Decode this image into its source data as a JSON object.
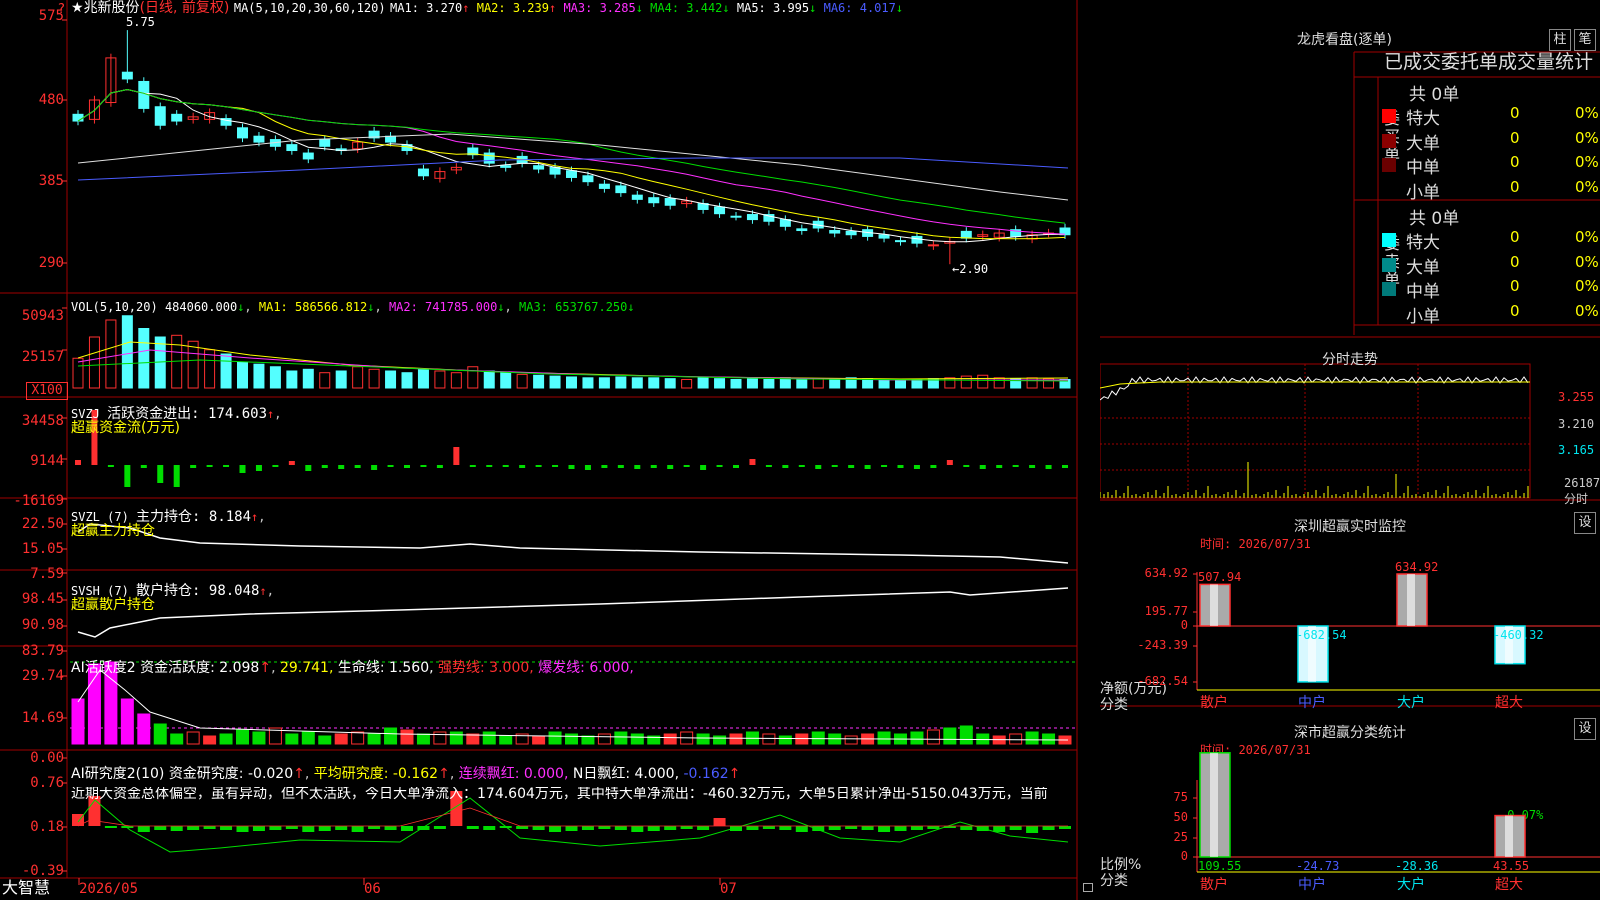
{
  "brand": "大智慧",
  "stock": {
    "star": "★",
    "name": "兆新股份",
    "mode": "(日线, 前复权)"
  },
  "price_panel": {
    "ma_label": "MA(5,10,20,30,60,120)",
    "ma": [
      {
        "label": "MA1:",
        "value": "3.270",
        "arrow": "↑",
        "color": "#ffffff"
      },
      {
        "label": "MA2:",
        "value": "3.239",
        "arrow": "↑",
        "color": "#ffff00"
      },
      {
        "label": "MA3:",
        "value": "3.285",
        "arrow": "↓",
        "color": "#ff30ff"
      },
      {
        "label": "MA4:",
        "value": "3.442",
        "arrow": "↓",
        "color": "#00dd00"
      },
      {
        "label": "MA5:",
        "value": "3.995",
        "arrow": "↓",
        "color": "#ffffff"
      },
      {
        "label": "MA6:",
        "value": "4.017",
        "arrow": "↓",
        "color": "#4a5cff"
      }
    ],
    "y_ticks": [
      "575",
      "480",
      "385",
      "290"
    ],
    "high_label": "5.75",
    "low_label": "←2.90"
  },
  "vol_panel": {
    "title": "VOL(5,10,20)",
    "value": "484060.000",
    "ma1": "MA1: 586566.812",
    "ma2": "MA2: 741785.000",
    "ma3": "MA3: 653767.250",
    "y_ticks": [
      "50943",
      "25157"
    ],
    "unit": "X100"
  },
  "svzj_panel": {
    "title": "SVZJ",
    "text": "活跃资金进出: 174.603",
    "sub": "超赢资金流(万元)",
    "y_ticks": [
      "34458",
      "9144",
      "-16169"
    ]
  },
  "svzl_panel": {
    "title": "SVZL (7)",
    "text": "主力持仓: 8.184",
    "sub": "超赢主力持仓",
    "y_ticks": [
      "22.50",
      "15.05",
      "7.59"
    ]
  },
  "svsh_panel": {
    "title": "SVSH (7)",
    "text": "散户持仓: 98.048",
    "sub": "超赢散户持仓",
    "y_ticks": [
      "98.45",
      "90.98",
      "83.79"
    ]
  },
  "ai_active_panel": {
    "title": "AI活跃度2",
    "t1": "资金活跃度: 2.098",
    "t2": "29.741,",
    "t3": "生命线: 1.560,",
    "t4": "强势线: 3.000,",
    "t5": "爆发线: 6.000,",
    "y_ticks": [
      "29.74",
      "14.69",
      "0.00"
    ]
  },
  "ai_research_panel": {
    "title": "AI研究度2(10)",
    "t1": "资金研究度: -0.020",
    "t2": "平均研究度: -0.162",
    "t3": "连续飘红: 0.000,",
    "t4": "N日飘红: 4.000,",
    "t5": "-0.162",
    "desc": "近期大资金总体偏空，虽有异动，但不太活跃，今日大单净流入：174.604万元，其中特大单净流出：-460.32万元，大单5日累计净出-5150.043万元，当前",
    "y_ticks": [
      "0.76",
      "0.18",
      "-0.39"
    ]
  },
  "x_dates": [
    "2026/05",
    "06",
    "07"
  ],
  "dragon": {
    "title": "龙虎看盘(逐单)",
    "btn1": "柱",
    "btn2": "笔",
    "subtitle": "已成交委托单成交量统计",
    "buy_label": [
      "委",
      "买",
      "单"
    ],
    "sell_label": [
      "委",
      "卖",
      "单"
    ],
    "buy_total": "共 0单",
    "sell_total": "共 0单",
    "buy_rows": [
      {
        "name": "特大",
        "count": "0",
        "pct": "0%",
        "color": "#ff0000"
      },
      {
        "name": "大单",
        "count": "0",
        "pct": "0%",
        "color": "#8b0000"
      },
      {
        "name": "中单",
        "count": "0",
        "pct": "0%",
        "color": "#6a0000"
      },
      {
        "name": "小单",
        "count": "0",
        "pct": "0%",
        "color": ""
      }
    ],
    "sell_rows": [
      {
        "name": "特大",
        "count": "0",
        "pct": "0%",
        "color": "#00ffff"
      },
      {
        "name": "大单",
        "count": "0",
        "pct": "0%",
        "color": "#008b8b"
      },
      {
        "name": "中单",
        "count": "0",
        "pct": "0%",
        "color": "#007a7a"
      },
      {
        "name": "小单",
        "count": "0",
        "pct": "0%",
        "color": ""
      }
    ]
  },
  "intraday": {
    "title": "分时走势",
    "y_ticks": [
      "3.255",
      "3.210",
      "3.165"
    ],
    "vol_tick": "26187",
    "vol_label": "分时"
  },
  "sz_monitor": {
    "title": "深圳超赢实时监控",
    "btn": "设",
    "time": "时间: 2026/07/31",
    "y_ticks": [
      "634.92",
      "195.77",
      "0",
      "-243.39",
      "-682.54"
    ],
    "ylabel1": "净额(万元)",
    "ylabel2": "分类",
    "chart_data": {
      "type": "bar",
      "categories": [
        "散户",
        "中户",
        "大户",
        "超大"
      ],
      "values": [
        507.94,
        -682.54,
        634.92,
        -460.32
      ],
      "value_labels": [
        "507.94",
        "-682.54",
        "634.92",
        "-460.32"
      ],
      "ylim": [
        -682.54,
        634.92
      ]
    }
  },
  "sz_class": {
    "title": "深市超赢分类统计",
    "btn": "设",
    "time": "时间: 2026/07/31",
    "y_ticks": [
      "75",
      "50",
      "25",
      "0"
    ],
    "ylabel1": "比例%",
    "ylabel2": "分类",
    "top_label": "-0.07%",
    "chart_data": {
      "type": "bar",
      "categories": [
        "散户",
        "中户",
        "大户",
        "超大"
      ],
      "values": [
        109.55,
        -24.73,
        -28.36,
        43.55
      ],
      "value_labels": [
        "109.55",
        "-24.73",
        "-28.36",
        "43.55"
      ],
      "ylim": [
        0,
        90
      ]
    }
  }
}
